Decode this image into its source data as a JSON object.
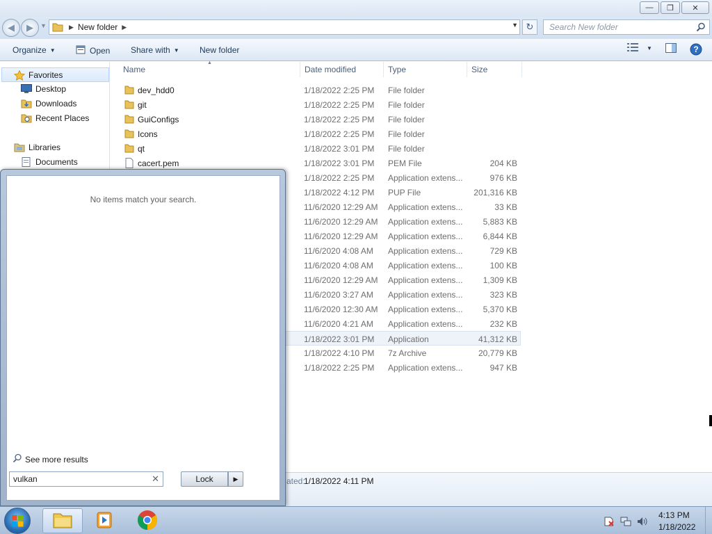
{
  "window": {
    "address": {
      "folder": "New folder"
    },
    "search_placeholder": "Search New folder",
    "toolbar": {
      "organize": "Organize",
      "open": "Open",
      "share_with": "Share with",
      "new_folder": "New folder"
    },
    "nav": {
      "favorites": "Favorites",
      "desktop": "Desktop",
      "downloads": "Downloads",
      "recent_places": "Recent Places",
      "libraries": "Libraries",
      "documents": "Documents"
    },
    "columns": {
      "name": "Name",
      "date_modified": "Date modified",
      "type": "Type",
      "size": "Size"
    },
    "files": [
      {
        "name": "dev_hdd0",
        "date": "1/18/2022 2:25 PM",
        "type": "File folder",
        "size": "",
        "icon": "folder-icon"
      },
      {
        "name": "git",
        "date": "1/18/2022 2:25 PM",
        "type": "File folder",
        "size": "",
        "icon": "folder-icon"
      },
      {
        "name": "GuiConfigs",
        "date": "1/18/2022 2:25 PM",
        "type": "File folder",
        "size": "",
        "icon": "folder-icon"
      },
      {
        "name": "Icons",
        "date": "1/18/2022 2:25 PM",
        "type": "File folder",
        "size": "",
        "icon": "folder-icon"
      },
      {
        "name": "qt",
        "date": "1/18/2022 3:01 PM",
        "type": "File folder",
        "size": "",
        "icon": "folder-icon"
      },
      {
        "name": "cacert.pem",
        "date": "1/18/2022 3:01 PM",
        "type": "PEM File",
        "size": "204 KB",
        "icon": "file-icon"
      },
      {
        "name": "",
        "date": "1/18/2022 2:25 PM",
        "type": "Application extens...",
        "size": "976 KB"
      },
      {
        "name": "",
        "date": "1/18/2022 4:12 PM",
        "type": "PUP File",
        "size": "201,316 KB"
      },
      {
        "name": "",
        "date": "11/6/2020 12:29 AM",
        "type": "Application extens...",
        "size": "33 KB"
      },
      {
        "name": "",
        "date": "11/6/2020 12:29 AM",
        "type": "Application extens...",
        "size": "5,883 KB"
      },
      {
        "name": "",
        "date": "11/6/2020 12:29 AM",
        "type": "Application extens...",
        "size": "6,844 KB"
      },
      {
        "name": "",
        "date": "11/6/2020 4:08 AM",
        "type": "Application extens...",
        "size": "729 KB"
      },
      {
        "name": "",
        "date": "11/6/2020 4:08 AM",
        "type": "Application extens...",
        "size": "100 KB"
      },
      {
        "name": "",
        "date": "11/6/2020 12:29 AM",
        "type": "Application extens...",
        "size": "1,309 KB"
      },
      {
        "name": "",
        "date": "11/6/2020 3:27 AM",
        "type": "Application extens...",
        "size": "323 KB"
      },
      {
        "name": "",
        "date": "11/6/2020 12:30 AM",
        "type": "Application extens...",
        "size": "5,370 KB"
      },
      {
        "name": "",
        "date": "11/6/2020 4:21 AM",
        "type": "Application extens...",
        "size": "232 KB"
      },
      {
        "name": "",
        "date": "1/18/2022 3:01 PM",
        "type": "Application",
        "size": "41,312 KB",
        "highlighted": true
      },
      {
        "name": "",
        "date": "1/18/2022 4:10 PM",
        "type": "7z Archive",
        "size": "20,779 KB"
      },
      {
        "name": "",
        "date": "1/18/2022 2:25 PM",
        "type": "Application extens...",
        "size": "947 KB"
      }
    ],
    "details": {
      "label": "ated:",
      "value": "1/18/2022 4:11 PM"
    }
  },
  "start_menu": {
    "no_items": "No items match your search.",
    "see_more": "See more results",
    "search_value": "vulkan",
    "lock_label": "Lock"
  },
  "taskbar": {
    "time": "4:13 PM",
    "date": "1/18/2022"
  },
  "colors": {
    "accent": "#1e395b",
    "folder": "#e8c25a",
    "selection": "#dbeafc"
  }
}
